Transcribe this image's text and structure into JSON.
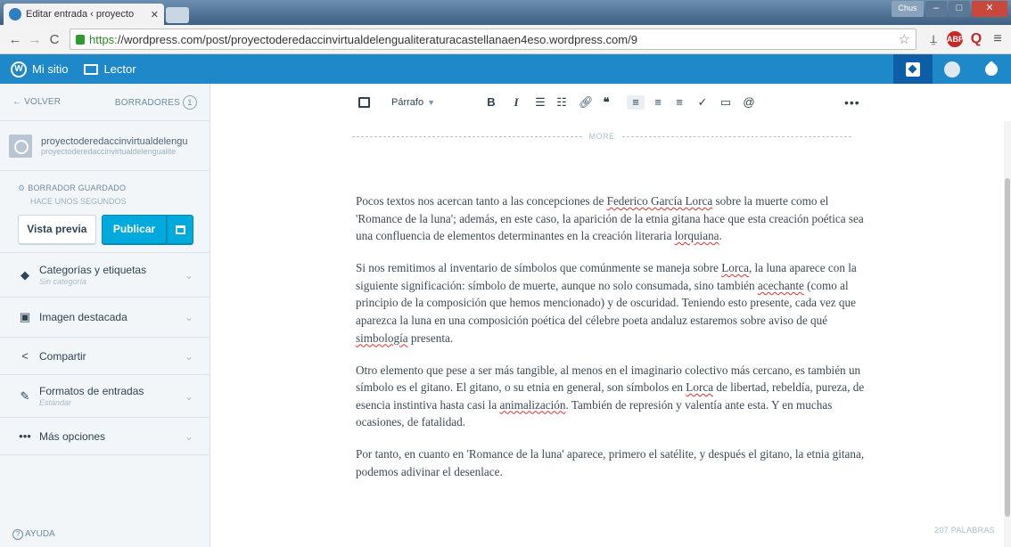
{
  "browser": {
    "tab_title": "Editar entrada ‹ proyecto",
    "tab_close": "✕",
    "window_user": "Chus",
    "url_scheme": "https:",
    "url_rest": "//wordpress.com/post/proyectoderedaccinvirtualdelengualiteraturacastellanaen4eso.wordpress.com/9"
  },
  "masterbar": {
    "my_site": "Mi sitio",
    "reader": "Lector"
  },
  "sidebar": {
    "back": "← VOLVER",
    "drafts": "BORRADORES",
    "drafts_count": "1",
    "site_name": "proyectoderedaccinvirtualdelengu",
    "site_sub": "proyectoderedaccinvirtualdelengualite",
    "status": "BORRADOR GUARDADO",
    "status_when": "HACE UNOS SEGUNDOS",
    "preview_label": "Vista previa",
    "publish_label": "Publicar",
    "sections": [
      {
        "label": "Categorías y etiquetas",
        "sub": "Sin categoría"
      },
      {
        "label": "Imagen destacada"
      },
      {
        "label": "Compartir"
      },
      {
        "label": "Formatos de entradas",
        "sub": "Estándar"
      },
      {
        "label": "Más opciones"
      }
    ],
    "help": "AYUDA"
  },
  "toolbar": {
    "format": "Párrafo",
    "bold": "B",
    "italic": "I",
    "blockquote": "❝",
    "mention": "@",
    "more": "•••"
  },
  "editor": {
    "more_tag": "MORE",
    "p1": {
      "a": "Pocos textos nos acercan tanto a las concepciones de ",
      "s1": "Federico García Lorca",
      "b": " sobre la muerte como el 'Romance de la luna'; además, en este caso, la aparición de la etnia gitana hace que esta creación poética sea una confluencia de elementos determinantes en la creación literaria ",
      "s2": "lorquiana",
      "c": "."
    },
    "p2": {
      "a": "Si nos remitimos al inventario de símbolos que comúnmente se maneja sobre ",
      "s1": "Lorca",
      "b": ", la luna aparece con la siguiente significación: símbolo de muerte, aunque no solo consumada, sino también ",
      "s2": "acechante",
      "c": " (como al principio de la composición que hemos mencionado) y de oscuridad. Teniendo esto presente, cada vez que aparezca la luna en una composición poética del célebre poeta andaluz estaremos sobre aviso de qué ",
      "s3": "simbología",
      "d": " presenta."
    },
    "p3": {
      "a": "Otro elemento que pese a ser más tangible, al menos en el imaginario colectivo más cercano, es también un símbolo es el gitano. El gitano, o su etnia en general, son símbolos en ",
      "s1": "Lorca",
      "b": " de libertad, rebeldía, pureza, de esencia instintiva hasta casi la ",
      "s2": "animalización",
      "c": ". También de represión y valentía ante esta. Y en muchas ocasiones, de fatalidad."
    },
    "p4": "Por tanto, en cuanto en 'Romance de la luna' aparece, primero el satélite, y después el gitano, la etnia gitana, podemos adivinar el desenlace.",
    "word_count": "207 PALABRAS"
  }
}
